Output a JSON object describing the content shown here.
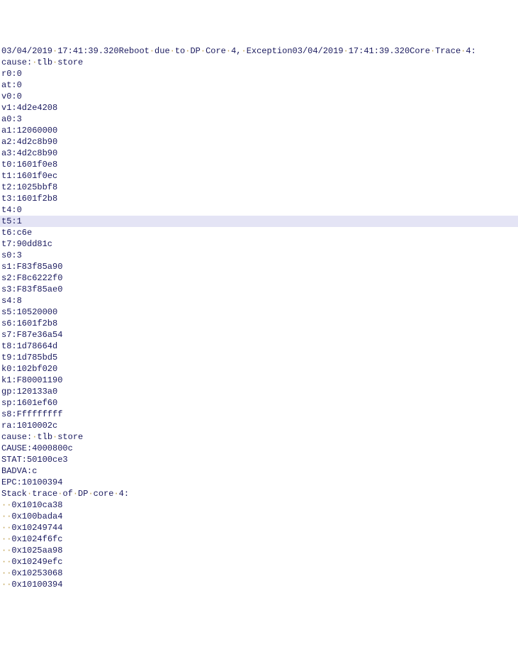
{
  "log": {
    "topCutLine": "03/04/2019·17:41:39.320Reboot·due·to·DP·Core·4,·Exception03/04/2019·17:41:39.320Core·Trace·4:",
    "highlightedIndex": 14,
    "lines": [
      "cause:·tlb·store",
      "r0:0",
      "at:0",
      "v0:0",
      "v1:4d2e4208",
      "a0:3",
      "a1:12060000",
      "a2:4d2c8b90",
      "a3:4d2c8b90",
      "t0:1601f0e8",
      "t1:1601f0ec",
      "t2:1025bbf8",
      "t3:1601f2b8",
      "t4:0",
      "t5:1",
      "t6:c6e",
      "t7:90dd81c",
      "s0:3",
      "s1:F83f85a90",
      "s2:F8c6222f0",
      "s3:F83f85ae0",
      "s4:8",
      "s5:10520000",
      "s6:1601f2b8",
      "s7:F87e36a54",
      "t8:1d78664d",
      "t9:1d785bd5",
      "k0:102bf020",
      "k1:F80001190",
      "gp:120133a0",
      "sp:1601ef60",
      "s8:Fffffffff",
      "ra:1010002c",
      "cause:·tlb·store",
      "CAUSE:4000800c",
      "STAT:50100ce3",
      "BADVA:c",
      "EPC:10100394",
      "Stack·trace·of·DP·core·4:",
      "··0x1010ca38",
      "··0x100bada4",
      "··0x10249744",
      "··0x1024f6fc",
      "··0x1025aa98",
      "··0x10249efc",
      "··0x10253068",
      "··0x10100394"
    ]
  }
}
